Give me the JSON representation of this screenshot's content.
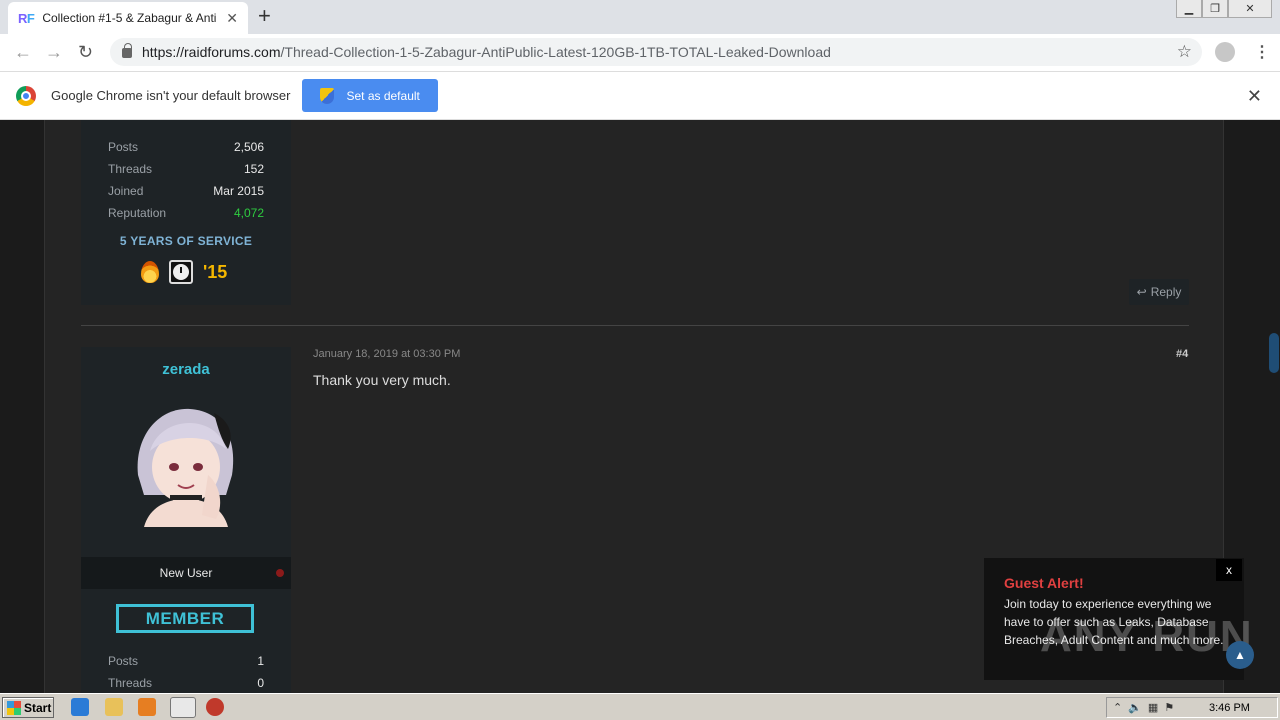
{
  "browser": {
    "tab_title": "Collection #1-5 & Zabagur & AntiPublic",
    "favicon": "RF",
    "url_host": "https://raidforums.com",
    "url_path": "/Thread-Collection-1-5-Zabagur-AntiPublic-Latest-120GB-1TB-TOTAL-Leaked-Download"
  },
  "infobar": {
    "message": "Google Chrome isn't your default browser",
    "button": "Set as default"
  },
  "prev_user": {
    "stats": [
      {
        "label": "Posts",
        "value": "2,506"
      },
      {
        "label": "Threads",
        "value": "152"
      },
      {
        "label": "Joined",
        "value": "Mar 2015"
      },
      {
        "label": "Reputation",
        "value": "4,072"
      }
    ],
    "service": "5 YEARS OF SERVICE",
    "year_badge": "'15"
  },
  "reply_label": "Reply",
  "post": {
    "username": "zerada",
    "rank": "New User",
    "badge": "MEMBER",
    "date": "January 18, 2019 at 03:30 PM",
    "number": "#4",
    "body": "Thank you very much.",
    "stats": [
      {
        "label": "Posts",
        "value": "1"
      },
      {
        "label": "Threads",
        "value": "0"
      }
    ]
  },
  "guest_alert": {
    "title": "Guest Alert!",
    "text": "Join today to experience everything we have to offer such as Leaks, Database Breaches, Adult Content and much more.",
    "close": "x"
  },
  "watermark": "ANY RUN",
  "taskbar": {
    "start": "Start",
    "time": "3:46 PM"
  }
}
